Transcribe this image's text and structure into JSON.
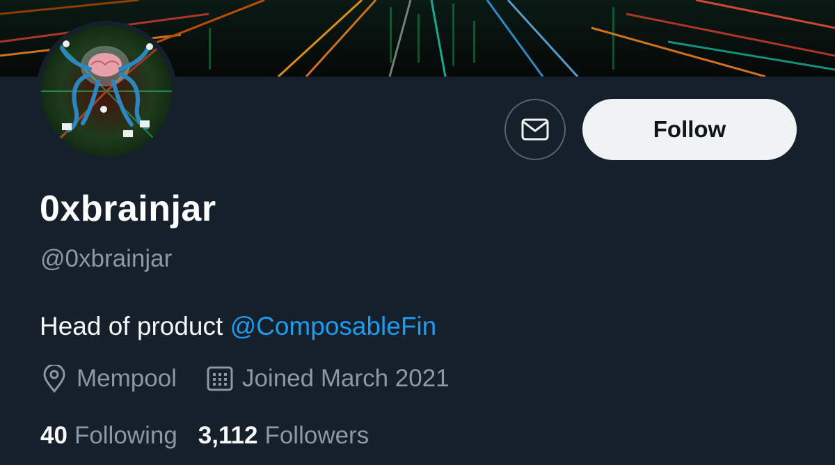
{
  "profile": {
    "display_name": "0xbrainjar",
    "handle": "@0xbrainjar",
    "bio_text": "Head of product ",
    "bio_link": "@ComposableFin",
    "location": "Mempool",
    "joined": "Joined March 2021"
  },
  "actions": {
    "follow_label": "Follow",
    "message_icon": "envelope-icon"
  },
  "stats": {
    "following_count": "40",
    "following_label": "Following",
    "followers_count": "3,112",
    "followers_label": "Followers"
  },
  "colors": {
    "background": "#15202b",
    "accent": "#1d9bf0",
    "secondary_text": "#8b98a5",
    "follow_button_bg": "#eff3f4"
  }
}
